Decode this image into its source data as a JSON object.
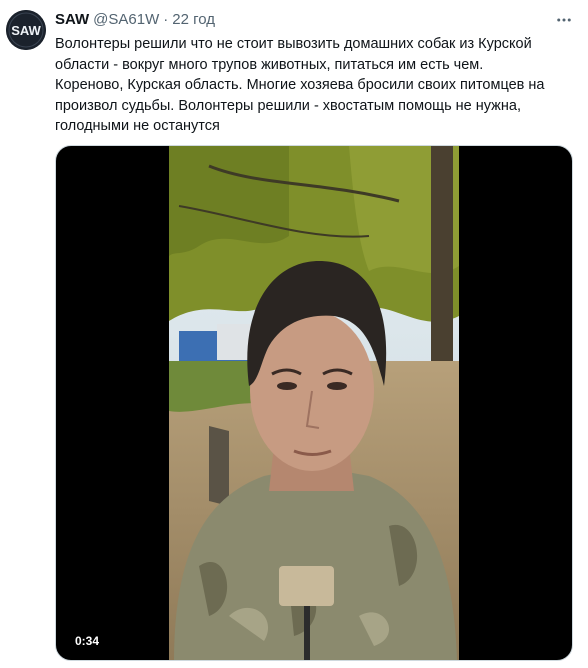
{
  "tweet": {
    "author": {
      "display_name": "SAW",
      "handle": "@SA61W",
      "avatar_text": "SAW",
      "avatar_icon": "saw-logo-avatar"
    },
    "separator": "·",
    "time": "22 год",
    "text_lines": [
      "Волонтеры решили что не стоит вывозить домашних собак из Курской",
      "области - вокруг много трупов животных, питаться им есть чем.",
      "Кореново, Курская область. Многие хозяева бросили своих питомцев на",
      "произвол судьбы. Волонтеры решили - хвостатым помощь не нужна,",
      "голодными не останутся"
    ],
    "more_icon": "more-horizontal-icon",
    "media": {
      "type": "video",
      "duration": "0:34",
      "colors": {
        "sky": "#d8e6ee",
        "foliage": "#7f8f2a",
        "camo": "#8b8a6e",
        "hair": "#2a2522",
        "skin": "#c79b82"
      }
    }
  }
}
